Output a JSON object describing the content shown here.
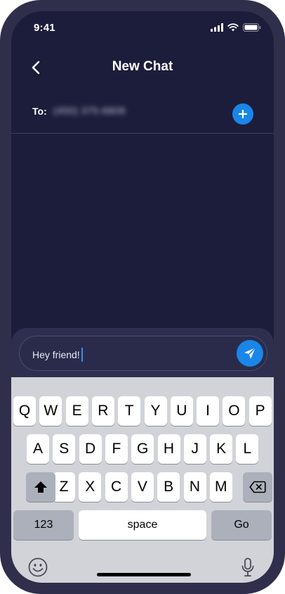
{
  "status_bar": {
    "time": "9:41"
  },
  "nav": {
    "title": "New Chat"
  },
  "recipient": {
    "label": "To:",
    "value": "(450) 375-6808"
  },
  "compose": {
    "text": "Hey friend!"
  },
  "keyboard": {
    "row1": [
      "Q",
      "W",
      "E",
      "R",
      "T",
      "Y",
      "U",
      "I",
      "O",
      "P"
    ],
    "row2": [
      "A",
      "S",
      "D",
      "F",
      "G",
      "H",
      "J",
      "K",
      "L"
    ],
    "row3": [
      "Z",
      "X",
      "C",
      "V",
      "B",
      "N",
      "M"
    ],
    "numbers_label": "123",
    "space_label": "space",
    "go_label": "Go"
  },
  "colors": {
    "background": "#1c1d3b",
    "accent": "#1a86e8",
    "keyboard": "#d1d3d9"
  }
}
